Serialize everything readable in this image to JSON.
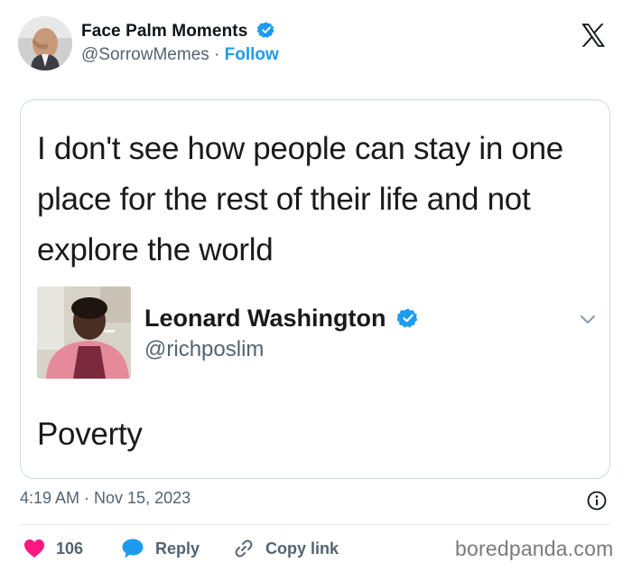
{
  "tweet": {
    "author": {
      "name": "Face Palm Moments",
      "handle": "@SorrowMemes",
      "separator": "·",
      "follow_label": "Follow"
    },
    "platform_logo": "x-logo-icon",
    "timestamp": "4:19 AM · Nov 15, 2023",
    "actions": {
      "likes_count": "106",
      "reply_label": "Reply",
      "copy_link_label": "Copy link"
    }
  },
  "quoted": {
    "text": "I don't see how people can stay in one place for the rest of their life and not explore the world",
    "reply": {
      "name": "Leonard Washington",
      "handle": "@richposlim",
      "text": "Poverty"
    }
  },
  "watermark": "boredpanda.com",
  "colors": {
    "accent": "#1d9bf0",
    "like": "#f91880",
    "muted": "#536471",
    "border": "#cfd9de"
  }
}
